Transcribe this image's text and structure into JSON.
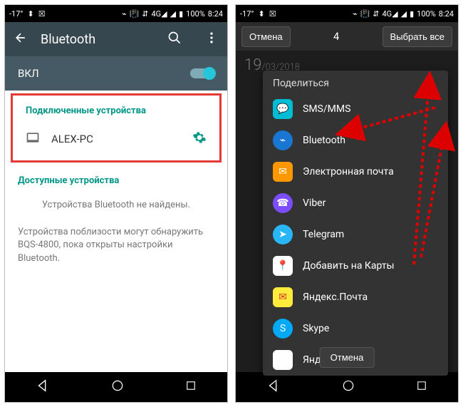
{
  "left": {
    "status": {
      "temp": "-17°",
      "battery": "100%",
      "time": "8:24"
    },
    "header": {
      "title": "Bluetooth"
    },
    "toggle": {
      "label": "ВКЛ"
    },
    "connected": {
      "title": "Подключенные устройства",
      "device": "ALEX-PC"
    },
    "available": {
      "title": "Доступные устройства",
      "none": "Устройства Bluetooth не найдены."
    },
    "hint": "Устройства поблизости могут обнаружить BQS-4800, пока открыты настройки Bluetooth."
  },
  "right": {
    "status": {
      "temp": "-17°",
      "battery": "100%",
      "time": "8:24"
    },
    "topbar": {
      "cancel": "Отмена",
      "count": "4",
      "select_all": "Выбрать все"
    },
    "date": {
      "day": "19",
      "rest": "/03/2018"
    },
    "share": {
      "title": "Поделиться",
      "items": {
        "sms": "SMS/MMS",
        "bluetooth": "Bluetooth",
        "email": "Электронная почта",
        "viber": "Viber",
        "telegram": "Telegram",
        "maps": "Добавить на Карты",
        "ymail": "Яндекс.Почта",
        "skype": "Skype",
        "ydisk": "Яндекс.Диск"
      }
    },
    "bottom_cancel": "Отмена"
  }
}
